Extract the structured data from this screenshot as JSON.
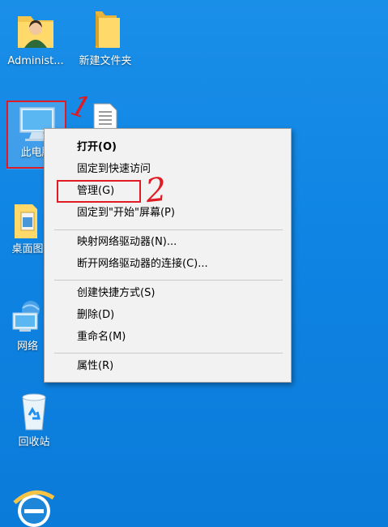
{
  "desktop": {
    "icons": [
      {
        "label": "Administ..."
      },
      {
        "label": "新建文件夹"
      },
      {
        "label": "此电脑"
      },
      {
        "label": "桌面图"
      },
      {
        "label": "网络"
      },
      {
        "label": "回收站"
      }
    ]
  },
  "context_menu": {
    "items": [
      {
        "label": "打开(O)"
      },
      {
        "label": "固定到快速访问"
      },
      {
        "label": "管理(G)"
      },
      {
        "label": "固定到\"开始\"屏幕(P)"
      },
      {
        "label": "映射网络驱动器(N)..."
      },
      {
        "label": "断开网络驱动器的连接(C)..."
      },
      {
        "label": "创建快捷方式(S)"
      },
      {
        "label": "删除(D)"
      },
      {
        "label": "重命名(M)"
      },
      {
        "label": "属性(R)"
      }
    ]
  },
  "annotations": {
    "step1": "1",
    "step2": "2",
    "color": "#e01b24"
  },
  "colors": {
    "desktop": "#0f84e3",
    "menu_bg": "#f2f2f2"
  }
}
